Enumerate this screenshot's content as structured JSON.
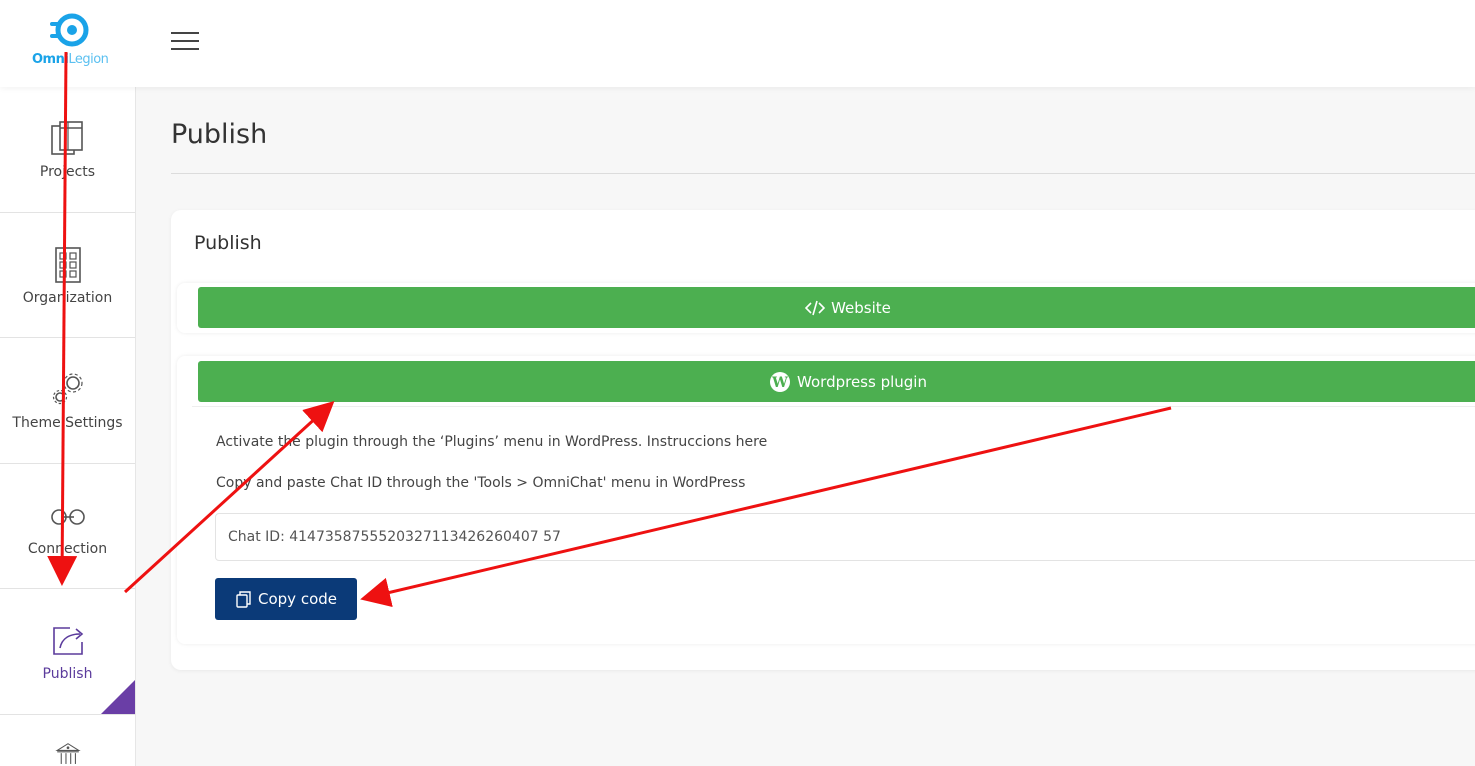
{
  "header": {
    "logo_text_bold": "Omni",
    "logo_text_light": "Legion"
  },
  "sidebar": {
    "items": [
      {
        "label": "Projects",
        "icon": "projects-icon",
        "active": false
      },
      {
        "label": "Organization",
        "icon": "building-icon",
        "active": false
      },
      {
        "label": "Theme Settings",
        "icon": "gears-icon",
        "active": false
      },
      {
        "label": "Connection",
        "icon": "link-icon",
        "active": false
      },
      {
        "label": "Publish",
        "icon": "share-icon",
        "active": true
      },
      {
        "label": "",
        "icon": "bank-icon",
        "active": false
      }
    ]
  },
  "main": {
    "page_title": "Publish",
    "card_title": "Publish",
    "website_label": "Website",
    "wordpress_label": "Wordpress plugin",
    "instruction_1": "Activate the plugin through the ‘Plugins’ menu in WordPress. Instruccions here",
    "instruction_2": "Copy and paste Chat ID through the 'Tools > OmniChat' menu in WordPress",
    "chat_id_text": "Chat ID: 4147358755520327113426260407 57",
    "copy_label": "Copy code"
  },
  "colors": {
    "green": "#4caf50",
    "navy": "#0b3a78",
    "purple": "#6a3ea6",
    "annotation_red": "#ee1111"
  }
}
